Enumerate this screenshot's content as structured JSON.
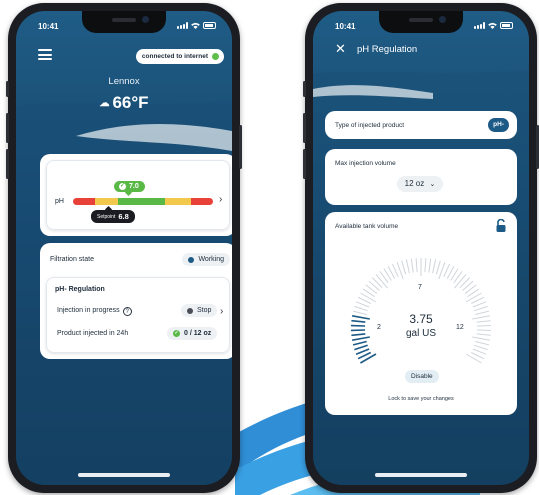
{
  "status_bar": {
    "time": "10:41"
  },
  "left_screen": {
    "connection": {
      "label": "connected to internet",
      "color": "#5fbf4a"
    },
    "location": "Lennox",
    "weather": {
      "temperature": "66°F",
      "icon": "cloud-icon"
    },
    "ph_card": {
      "label": "pH",
      "value": "7.0",
      "setpoint_label": "Setpoint",
      "setpoint_value": "6.8",
      "scale_colors": [
        "#e8413a",
        "#f2c94c",
        "#5ab946",
        "#f2c94c",
        "#e8413a"
      ]
    },
    "filtration": {
      "label": "Filtration state",
      "status": "Working",
      "status_color": "#1d5a86"
    },
    "ph_regulation": {
      "title": "pH- Regulation",
      "injection_label": "Injection in progress",
      "injection_help": "?",
      "injection_status": "Stop",
      "injection_status_color": "#4a4f57",
      "product_label": "Product injected in 24h",
      "product_value": "0 / 12 oz",
      "product_color": "#5ab946"
    }
  },
  "right_screen": {
    "header_title": "pH Regulation",
    "type_label": "Type of injected product",
    "type_value": "pH-",
    "max_injection_label": "Max injection volume",
    "max_injection_value": "12 oz",
    "tank_label": "Available tank volume",
    "gauge": {
      "min_label": "2",
      "mid_label": "7",
      "max_label": "12",
      "value": "3.75",
      "unit": "gal US",
      "fill_fraction": 0.175
    },
    "disable_label": "Disable",
    "lock_note": "Lock to save your changes"
  }
}
